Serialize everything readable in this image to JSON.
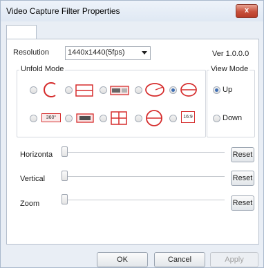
{
  "window": {
    "title": "Video Capture Filter Properties",
    "close_label": "x"
  },
  "resolution": {
    "label": "Resolution",
    "value": "1440x1440(5fps)"
  },
  "version": "Ver 1.0.0.0",
  "unfold": {
    "title": "Unfold Mode",
    "icon_text": {
      "r2_opt1": "360°",
      "r2_opt5": "16:9"
    },
    "selected_index": 4
  },
  "view": {
    "title": "View Mode",
    "up_label": "Up",
    "down_label": "Down",
    "selected": "Up"
  },
  "sliders": [
    {
      "label": "Horizonta",
      "reset_label": "Reset",
      "value": 0
    },
    {
      "label": "Vertical",
      "reset_label": "Reset",
      "value": 0
    },
    {
      "label": "Zoom",
      "reset_label": "Reset",
      "value": 0
    }
  ],
  "buttons": {
    "ok": "OK",
    "cancel": "Cancel",
    "apply": "Apply"
  },
  "colors": {
    "icon_red": "#d52b2b",
    "accent": "#3f6fb4"
  }
}
